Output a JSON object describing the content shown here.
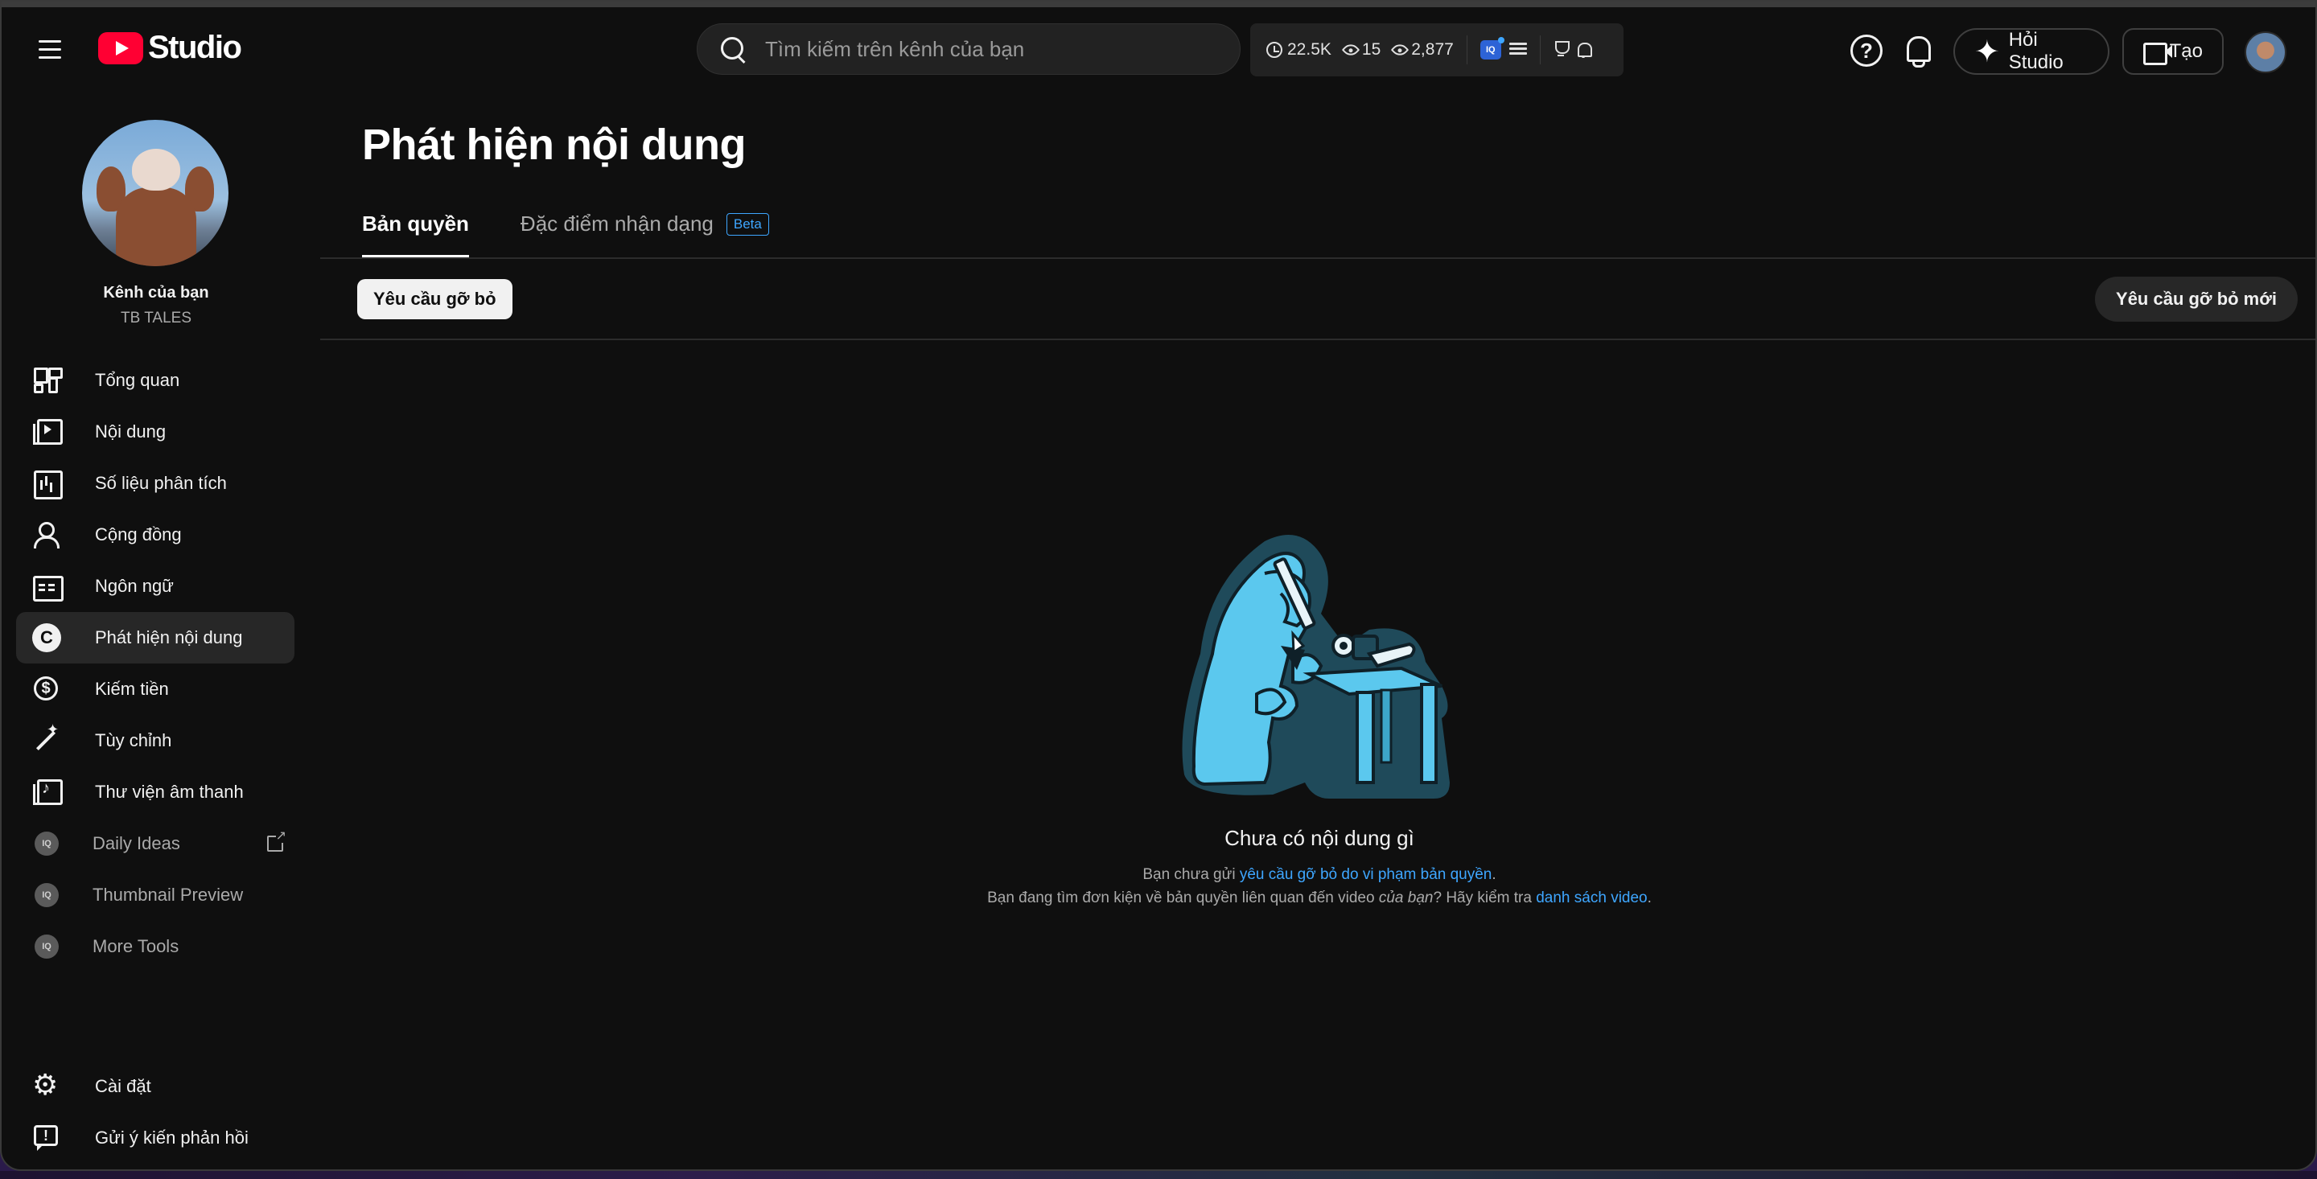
{
  "header": {
    "logo_text": "Studio",
    "search_placeholder": "Tìm kiếm trên kênh của bạn",
    "stats": {
      "watch": "22.5K",
      "views_small": "15",
      "views_total": "2,877",
      "iq_label": "IQ"
    },
    "help_symbol": "?",
    "ask_label": "Hỏi Studio",
    "create_label": "Tạo"
  },
  "channel": {
    "label": "Kênh của bạn",
    "name": "TB TALES"
  },
  "sidebar": {
    "items": [
      {
        "label": "Tổng quan",
        "icon": "dashboard-icon"
      },
      {
        "label": "Nội dung",
        "icon": "content-icon"
      },
      {
        "label": "Số liệu phân tích",
        "icon": "analytics-icon"
      },
      {
        "label": "Cộng đồng",
        "icon": "community-icon"
      },
      {
        "label": "Ngôn ngữ",
        "icon": "subtitles-icon"
      },
      {
        "label": "Phát hiện nội dung",
        "icon": "copyright-icon",
        "active": true,
        "icon_glyph": "C"
      },
      {
        "label": "Kiếm tiền",
        "icon": "monetization-icon"
      },
      {
        "label": "Tùy chỉnh",
        "icon": "customization-icon"
      },
      {
        "label": "Thư viện âm thanh",
        "icon": "audio-library-icon"
      },
      {
        "label": "Daily Ideas",
        "icon": "iq-icon"
      },
      {
        "label": "Thumbnail Preview",
        "icon": "iq-icon"
      },
      {
        "label": "More Tools",
        "icon": "iq-icon"
      }
    ],
    "bottom": [
      {
        "label": "Cài đặt",
        "icon": "settings-icon"
      },
      {
        "label": "Gửi ý kiến phản hồi",
        "icon": "feedback-icon"
      }
    ]
  },
  "main": {
    "title": "Phát hiện nội dung",
    "tabs": [
      {
        "label": "Bản quyền",
        "active": true
      },
      {
        "label": "Đặc điểm nhận dạng",
        "badge": "Beta"
      }
    ],
    "filter_chip": "Yêu cầu gỡ bỏ",
    "new_request_button": "Yêu cầu gỡ bỏ mới",
    "empty": {
      "title": "Chưa có nội dung gì",
      "line1_prefix": "Bạn chưa gửi ",
      "line1_link": "yêu cầu gỡ bỏ do vi phạm bản quyền",
      "line1_suffix": ".",
      "line2_prefix": "Bạn đang tìm đơn kiện về bản quyền liên quan đến video ",
      "line2_em": "của bạn",
      "line2_mid": "? Hãy kiểm tra ",
      "line2_link": "danh sách video",
      "line2_suffix": "."
    }
  },
  "colors": {
    "background": "#0f0f0f",
    "accent_link": "#3ea6ff",
    "youtube_red": "#ff0033",
    "illustration_blue": "#5bc8ee"
  }
}
